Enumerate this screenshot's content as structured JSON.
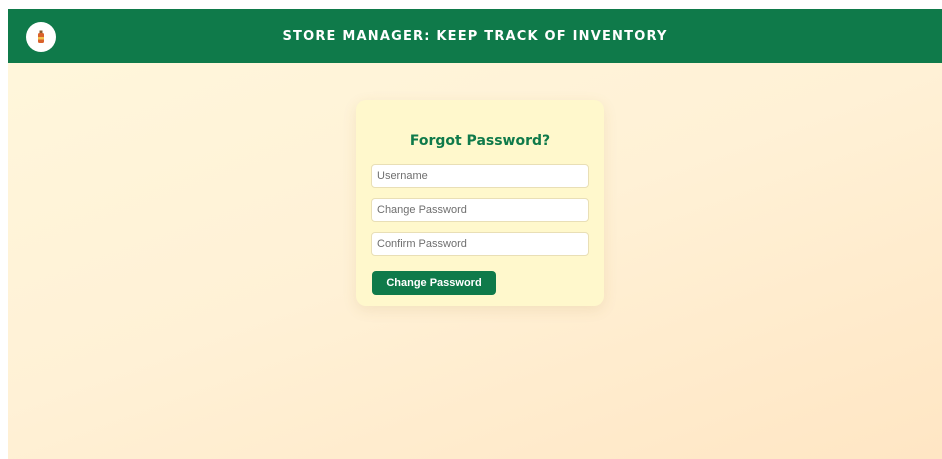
{
  "header": {
    "title": "STORE MANAGER: KEEP TRACK OF INVENTORY",
    "logo_icon": "bottle-logo-icon"
  },
  "form": {
    "title": "Forgot Password?",
    "username_placeholder": "Username",
    "change_password_placeholder": "Change Password",
    "confirm_password_placeholder": "Confirm Password",
    "submit_label": "Change Password"
  },
  "colors": {
    "brand_green": "#0f7a4a",
    "card_background": "#fff8cc",
    "page_background": "#fff1d6"
  }
}
